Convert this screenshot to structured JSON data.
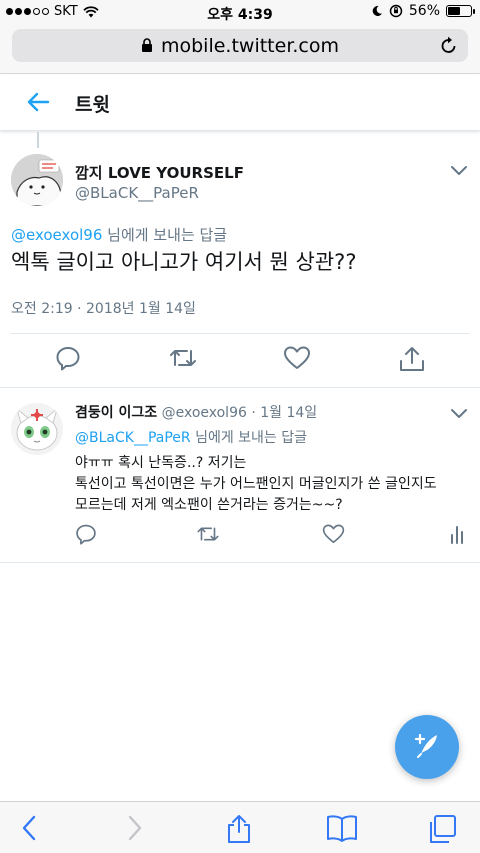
{
  "status_bar": {
    "carrier": "SKT",
    "time": "오후 4:39",
    "battery": "56%",
    "battery_level": 0.56
  },
  "url_bar": {
    "url": "mobile.twitter.com"
  },
  "header": {
    "title": "트윗"
  },
  "main_tweet": {
    "name": "깜지 LOVE YOURSELF",
    "handle": "@BLaCK__PaPeR",
    "reply_mention": "@exoexol96",
    "reply_suffix": " 님에게 보내는 답글",
    "text": "엑톡 글이고 아니고가 여기서 뭔 상관??",
    "date": "오전 2:19 · 2018년 1월 14일"
  },
  "reply_tweet": {
    "name": "겸둥이 이그조",
    "handle_date": " @exoexol96 · 1월 14일",
    "reply_mention": "@BLaCK__PaPeR",
    "reply_suffix": " 님에게 보내는 답글",
    "text_line1": "야ㅠㅠ 혹시 난독증..? 저기는",
    "text_line2": "톡선이고 톡선이면은 누가 어느팬인지 머글인지가 쓴 글인지도",
    "text_line3": "모르는데 저게 엑소팬이 쓴거라는 증거는~~?"
  },
  "colors": {
    "accent": "#1da1f2",
    "fab": "#4aa1eb",
    "muted": "#657786",
    "safari_blue": "#3478f6"
  },
  "icons": {
    "back": "back-arrow-icon",
    "reply": "reply-icon",
    "retweet": "retweet-icon",
    "like": "heart-icon",
    "share": "share-icon",
    "analytics": "analytics-icon",
    "compose": "compose-icon"
  }
}
